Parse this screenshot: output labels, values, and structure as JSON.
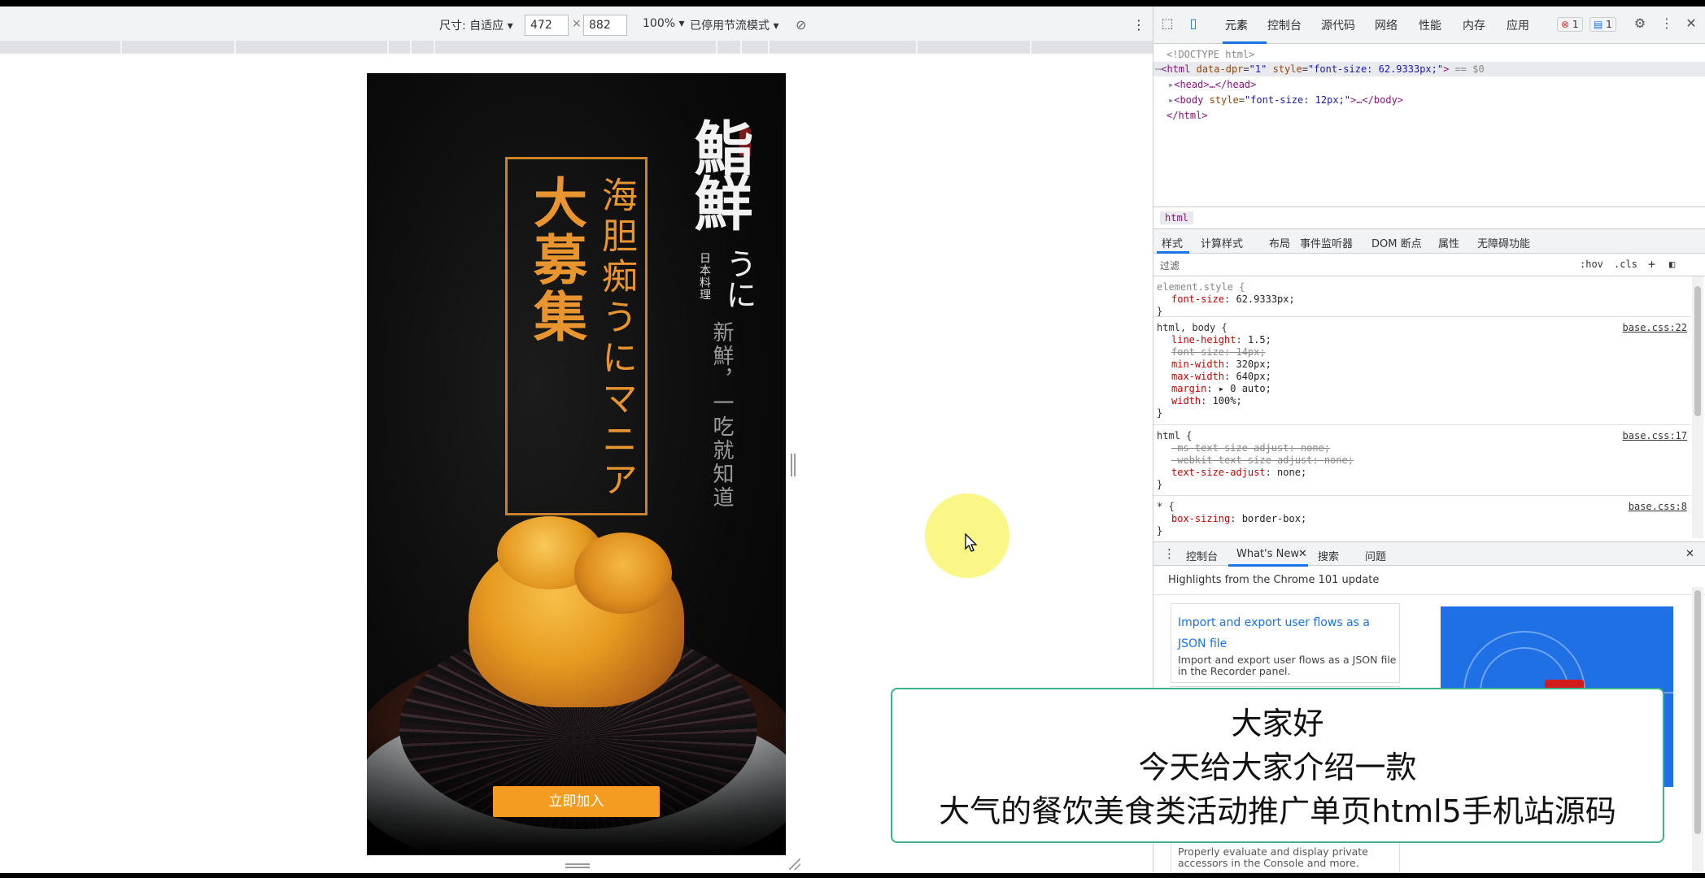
{
  "device_toolbar": {
    "dimensions_label": "尺寸: 自适应",
    "width_value": "472",
    "height_value": "882",
    "times": "×",
    "zoom": "100%",
    "throttle": "已停用节流模式",
    "more": "⋮"
  },
  "page": {
    "logo_main": "鮨鮮",
    "logo_small": "日本料理",
    "logo_kana": "うに",
    "slogan": "新鮮，一吃就知道",
    "title_big": "大募集",
    "title_sub": "海胆痴うにマニア",
    "join_button": "立即加入"
  },
  "devtools": {
    "tabs": [
      "元素",
      "控制台",
      "源代码",
      "网络",
      "性能",
      "内存",
      "应用"
    ],
    "error_count": "1",
    "message_count": "1",
    "dom": {
      "doctype": "<!DOCTYPE html>",
      "html_open_prefix": "⋯",
      "html_tag": "html",
      "html_attr1_name": "data-dpr",
      "html_attr1_val": "\"1\"",
      "html_attr2_name": "style",
      "html_attr2_val": "\"font-size: 62.9333px;\"",
      "eq0": "== $0",
      "head_line": "<head>…</head>",
      "body_prefix": "<body",
      "body_attr_name": "style",
      "body_attr_val": "\"font-size: 12px;\"",
      "body_suffix": ">…</body>",
      "html_close": "</html>"
    },
    "breadcrumb": "html",
    "styles_tabs": [
      "样式",
      "计算样式",
      "布局",
      "事件监听器",
      "DOM 断点",
      "属性",
      "无障碍功能"
    ],
    "filter_placeholder": "过滤",
    "filter_hov": ":hov",
    "filter_cls": ".cls",
    "rules": [
      {
        "selector": "element.style {",
        "source": "",
        "props": [
          {
            "name": "font-size",
            "value": "62.9333px;",
            "struck": false
          }
        ]
      },
      {
        "selector": "html, body {",
        "source": "base.css:22",
        "props": [
          {
            "name": "line-height",
            "value": "1.5;",
            "struck": false
          },
          {
            "name": "font-size",
            "value": "14px;",
            "struck": true
          },
          {
            "name": "min-width",
            "value": "320px;",
            "struck": false
          },
          {
            "name": "max-width",
            "value": "640px;",
            "struck": false
          },
          {
            "name": "margin",
            "value": "▸ 0 auto;",
            "struck": false
          },
          {
            "name": "width",
            "value": "100%;",
            "struck": false
          }
        ]
      },
      {
        "selector": "html {",
        "source": "base.css:17",
        "props": [
          {
            "name": "-ms-text-size-adjust",
            "value": "none;",
            "struck": true
          },
          {
            "name": "-webkit-text-size-adjust",
            "value": "none;",
            "struck": true
          },
          {
            "name": "text-size-adjust",
            "value": "none;",
            "struck": false
          }
        ]
      },
      {
        "selector": "* {",
        "source": "base.css:8",
        "props": [
          {
            "name": "box-sizing",
            "value": "border-box;",
            "struck": false
          }
        ]
      }
    ],
    "close_brace": "}",
    "drawer_tabs": [
      "控制台",
      "What's New",
      "搜索",
      "问题"
    ],
    "whats_new_head": "Highlights from the Chrome 101 update",
    "card1_title": "Import and export user flows as a JSON file",
    "card1_desc": "Import and export user flows as a JSON file in the Recorder panel.",
    "card2_desc": "Properly evaluate and display private accessors in the Console and more."
  },
  "subtitle": {
    "line1": "大家好",
    "line2": "今天给大家介绍一款",
    "line3": "大气的餐饮美食类活动推广单页html5手机站源码"
  },
  "colors": {
    "accent_orange": "#f39c21",
    "gold": "#e8942f",
    "devtools_blue": "#1a73e8",
    "subtitle_border": "#3bb38a"
  }
}
